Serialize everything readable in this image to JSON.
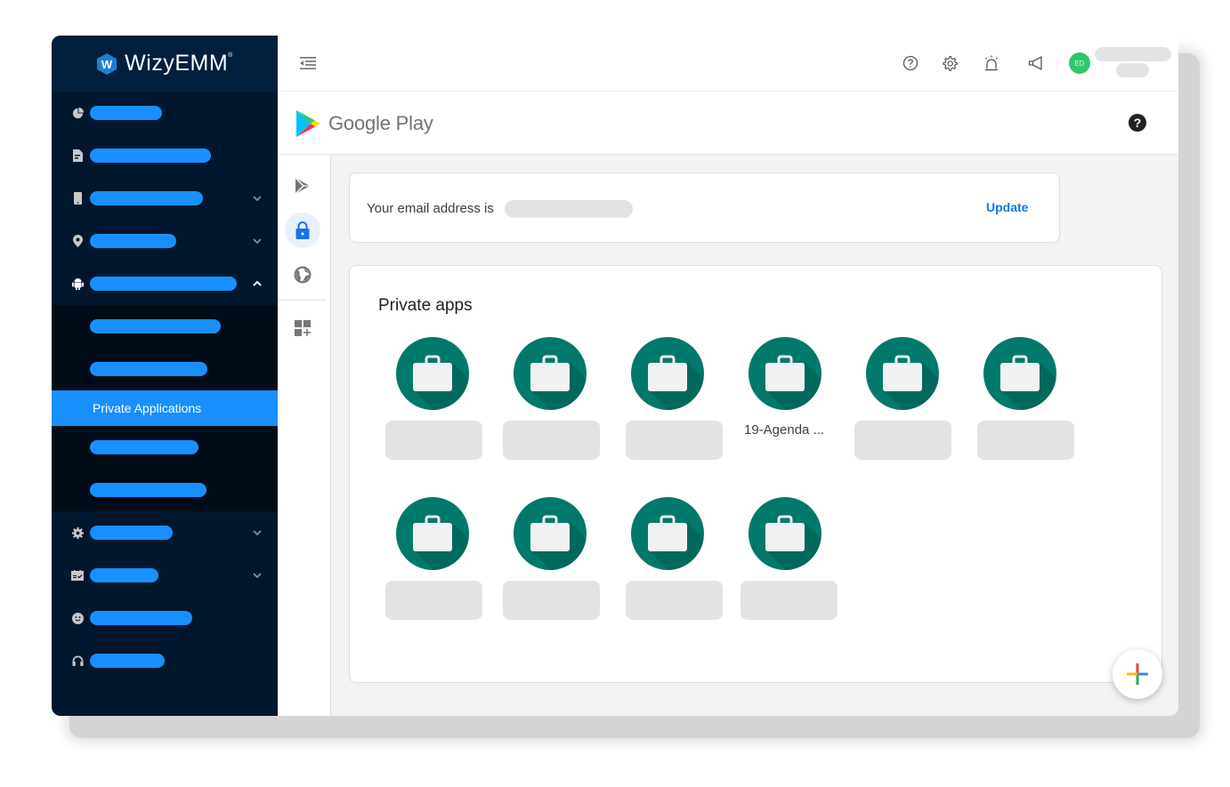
{
  "app": {
    "logo_text": "WizyEMM",
    "logo_mark": "W",
    "trademark": "®"
  },
  "colors": {
    "sidebar_bg": "#01172d",
    "accent": "#1890ff",
    "app_icon": "#00796b",
    "avatar": "#2fc66c",
    "link": "#1a73e8"
  },
  "sidebar": {
    "items": [
      {
        "icon": "pie-chart-icon",
        "label_redacted": true,
        "has_chevron": false
      },
      {
        "icon": "document-icon",
        "label_redacted": true,
        "has_chevron": false
      },
      {
        "icon": "phone-icon",
        "label_redacted": true,
        "has_chevron": true,
        "expanded": false
      },
      {
        "icon": "location-pin-icon",
        "label_redacted": true,
        "has_chevron": true,
        "expanded": false
      },
      {
        "icon": "android-icon",
        "label_redacted": true,
        "has_chevron": true,
        "expanded": true,
        "children": [
          {
            "label_redacted": true
          },
          {
            "label_redacted": true
          },
          {
            "label": "Private Applications",
            "active": true
          },
          {
            "label_redacted": true
          },
          {
            "label_redacted": true
          }
        ]
      },
      {
        "icon": "gear-icon",
        "label_redacted": true,
        "has_chevron": true,
        "expanded": false
      },
      {
        "icon": "calendar-check-icon",
        "label_redacted": true,
        "has_chevron": true,
        "expanded": false
      },
      {
        "icon": "smiley-icon",
        "label_redacted": true,
        "has_chevron": false
      },
      {
        "icon": "headphones-icon",
        "label_redacted": true,
        "has_chevron": false
      }
    ],
    "active_label": "Private Applications"
  },
  "header": {
    "icons": [
      "help-circle-icon",
      "gear-icon",
      "alarm-icon",
      "megaphone-icon"
    ],
    "avatar_initials": "ED",
    "user_name_redacted": true,
    "user_role_redacted": true
  },
  "google_play": {
    "brand": "Google Play",
    "help_glyph": "?",
    "rail": [
      {
        "icon": "play-store-icon",
        "active": false
      },
      {
        "icon": "lock-icon",
        "active": true
      },
      {
        "icon": "globe-icon",
        "active": false
      },
      {
        "icon": "add-widget-icon",
        "active": false
      }
    ],
    "email": {
      "label": "Your email address is",
      "value_redacted": true,
      "update_label": "Update"
    },
    "private_apps": {
      "title": "Private apps",
      "apps": [
        {
          "name": null,
          "redacted": true
        },
        {
          "name": null,
          "redacted": true
        },
        {
          "name": null,
          "redacted": true
        },
        {
          "name": "19-Agenda ...",
          "redacted": false
        },
        {
          "name": null,
          "redacted": true
        },
        {
          "name": null,
          "redacted": true
        },
        {
          "name": null,
          "redacted": true
        },
        {
          "name": null,
          "redacted": true
        },
        {
          "name": null,
          "redacted": true
        },
        {
          "name": null,
          "redacted": true
        }
      ]
    },
    "fab_label": "+"
  }
}
